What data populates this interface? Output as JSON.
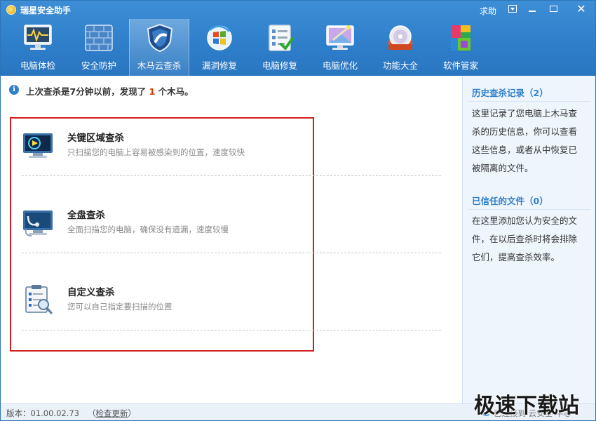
{
  "window": {
    "title": "瑞星安全助手",
    "help_label": "求助",
    "close_glyph": "✕"
  },
  "toolbar": {
    "items": [
      {
        "label": "电脑体检",
        "icon": "monitor-pulse-icon"
      },
      {
        "label": "安全防护",
        "icon": "firewall-icon"
      },
      {
        "label": "木马云查杀",
        "icon": "shield-icon",
        "active": true
      },
      {
        "label": "漏洞修复",
        "icon": "windows-patch-icon"
      },
      {
        "label": "电脑修复",
        "icon": "checklist-icon"
      },
      {
        "label": "电脑优化",
        "icon": "magic-monitor-icon"
      },
      {
        "label": "功能大全",
        "icon": "disc-box-icon"
      },
      {
        "label": "软件管家",
        "icon": "software-blocks-icon"
      }
    ]
  },
  "notice": {
    "prefix": "上次查杀是7分钟以前，发现了",
    "count": "1",
    "suffix": "个木马。"
  },
  "scan_options": [
    {
      "title": "关键区域查杀",
      "desc": "只扫描您的电脑上容易被感染到的位置，速度较快",
      "icon": "quick-scan-monitor-icon"
    },
    {
      "title": "全盘查杀",
      "desc": "全面扫描您的电脑，确保没有遗漏，速度较慢",
      "icon": "full-scan-monitor-icon"
    },
    {
      "title": "自定义查杀",
      "desc": "您可以自己指定要扫描的位置",
      "icon": "custom-scan-clipboard-icon"
    }
  ],
  "sidebar": {
    "history_title": "历史查杀记录（2）",
    "history_desc": "这里记录了您电脑上木马查杀的历史信息，你可以查看这些信息，或者从中恢复已被隔离的文件。",
    "trusted_title": "已信任的文件（0）",
    "trusted_desc": "在这里添加您认为安全的文件，在以后查杀时将会排除它们，提高查杀效率。"
  },
  "statusbar": {
    "version": "版本：01.00.02.73",
    "update_open": "（",
    "update_label": "检查更新",
    "update_close": "）",
    "cloud_status": "已连接到 云安全 中心"
  },
  "watermark": "极速下载站",
  "colors": {
    "accent": "#2f7fcb",
    "highlight_frame": "#d21f1f",
    "notice_count": "#d33a00"
  }
}
